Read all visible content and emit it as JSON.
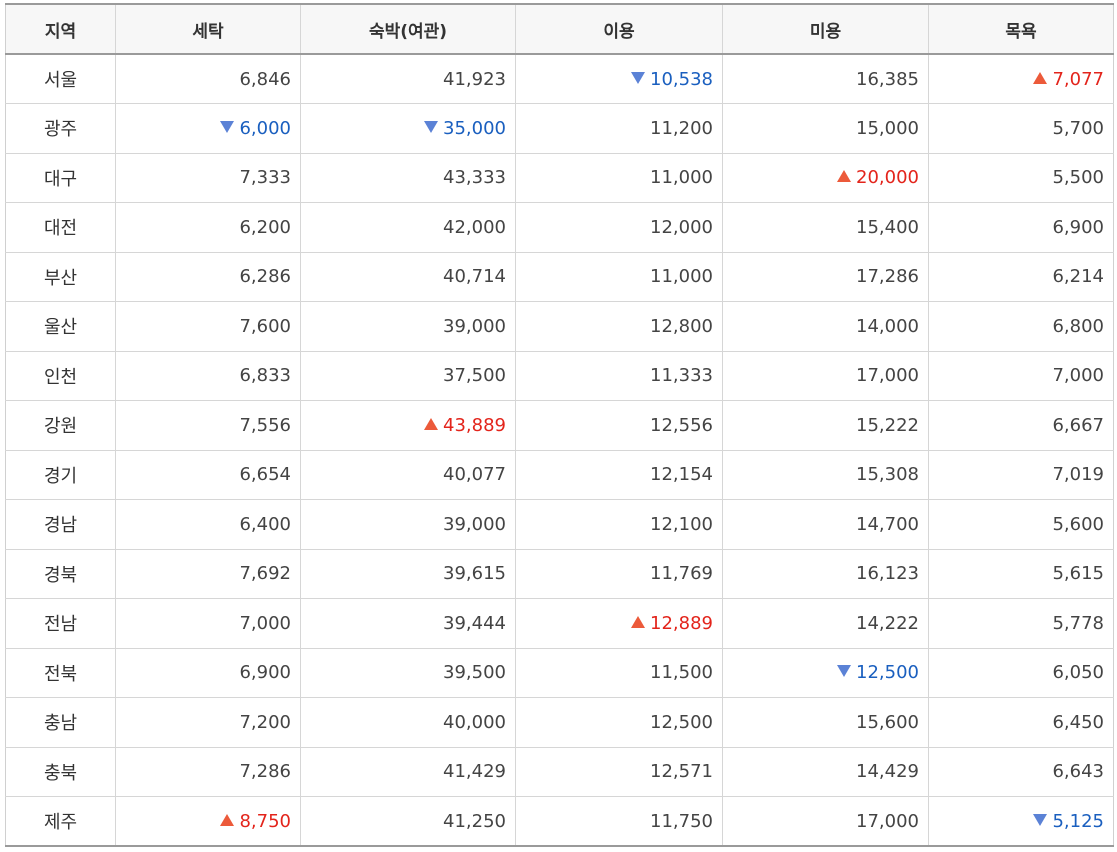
{
  "columns": [
    "지역",
    "세탁",
    "숙박(여관)",
    "이용",
    "미용",
    "목욕"
  ],
  "rows": [
    {
      "region": "서울",
      "cells": [
        {
          "value": "6,846"
        },
        {
          "value": "41,923"
        },
        {
          "value": "10,538",
          "trend": "down"
        },
        {
          "value": "16,385"
        },
        {
          "value": "7,077",
          "trend": "up"
        }
      ]
    },
    {
      "region": "광주",
      "cells": [
        {
          "value": "6,000",
          "trend": "down"
        },
        {
          "value": "35,000",
          "trend": "down"
        },
        {
          "value": "11,200"
        },
        {
          "value": "15,000"
        },
        {
          "value": "5,700"
        }
      ]
    },
    {
      "region": "대구",
      "cells": [
        {
          "value": "7,333"
        },
        {
          "value": "43,333"
        },
        {
          "value": "11,000"
        },
        {
          "value": "20,000",
          "trend": "up"
        },
        {
          "value": "5,500"
        }
      ]
    },
    {
      "region": "대전",
      "cells": [
        {
          "value": "6,200"
        },
        {
          "value": "42,000"
        },
        {
          "value": "12,000"
        },
        {
          "value": "15,400"
        },
        {
          "value": "6,900"
        }
      ]
    },
    {
      "region": "부산",
      "cells": [
        {
          "value": "6,286"
        },
        {
          "value": "40,714"
        },
        {
          "value": "11,000"
        },
        {
          "value": "17,286"
        },
        {
          "value": "6,214"
        }
      ]
    },
    {
      "region": "울산",
      "cells": [
        {
          "value": "7,600"
        },
        {
          "value": "39,000"
        },
        {
          "value": "12,800"
        },
        {
          "value": "14,000"
        },
        {
          "value": "6,800"
        }
      ]
    },
    {
      "region": "인천",
      "cells": [
        {
          "value": "6,833"
        },
        {
          "value": "37,500"
        },
        {
          "value": "11,333"
        },
        {
          "value": "17,000"
        },
        {
          "value": "7,000"
        }
      ]
    },
    {
      "region": "강원",
      "cells": [
        {
          "value": "7,556"
        },
        {
          "value": "43,889",
          "trend": "up"
        },
        {
          "value": "12,556"
        },
        {
          "value": "15,222"
        },
        {
          "value": "6,667"
        }
      ]
    },
    {
      "region": "경기",
      "cells": [
        {
          "value": "6,654"
        },
        {
          "value": "40,077"
        },
        {
          "value": "12,154"
        },
        {
          "value": "15,308"
        },
        {
          "value": "7,019"
        }
      ]
    },
    {
      "region": "경남",
      "cells": [
        {
          "value": "6,400"
        },
        {
          "value": "39,000"
        },
        {
          "value": "12,100"
        },
        {
          "value": "14,700"
        },
        {
          "value": "5,600"
        }
      ]
    },
    {
      "region": "경북",
      "cells": [
        {
          "value": "7,692"
        },
        {
          "value": "39,615"
        },
        {
          "value": "11,769"
        },
        {
          "value": "16,123"
        },
        {
          "value": "5,615"
        }
      ]
    },
    {
      "region": "전남",
      "cells": [
        {
          "value": "7,000"
        },
        {
          "value": "39,444"
        },
        {
          "value": "12,889",
          "trend": "up"
        },
        {
          "value": "14,222"
        },
        {
          "value": "5,778"
        }
      ]
    },
    {
      "region": "전북",
      "cells": [
        {
          "value": "6,900"
        },
        {
          "value": "39,500"
        },
        {
          "value": "11,500"
        },
        {
          "value": "12,500",
          "trend": "down"
        },
        {
          "value": "6,050"
        }
      ]
    },
    {
      "region": "충남",
      "cells": [
        {
          "value": "7,200"
        },
        {
          "value": "40,000"
        },
        {
          "value": "12,500"
        },
        {
          "value": "15,600"
        },
        {
          "value": "6,450"
        }
      ]
    },
    {
      "region": "충북",
      "cells": [
        {
          "value": "7,286"
        },
        {
          "value": "41,429"
        },
        {
          "value": "12,571"
        },
        {
          "value": "14,429"
        },
        {
          "value": "6,643"
        }
      ]
    },
    {
      "region": "제주",
      "cells": [
        {
          "value": "8,750",
          "trend": "up"
        },
        {
          "value": "41,250"
        },
        {
          "value": "11,750"
        },
        {
          "value": "17,000"
        },
        {
          "value": "5,125",
          "trend": "down"
        }
      ]
    }
  ],
  "colors": {
    "up": "#e3241b",
    "down": "#1a5fbf",
    "up_icon": "#ec5a3a",
    "down_icon": "#5b82d6"
  },
  "icons": {
    "up": "triangle-up-icon",
    "down": "triangle-down-icon"
  }
}
